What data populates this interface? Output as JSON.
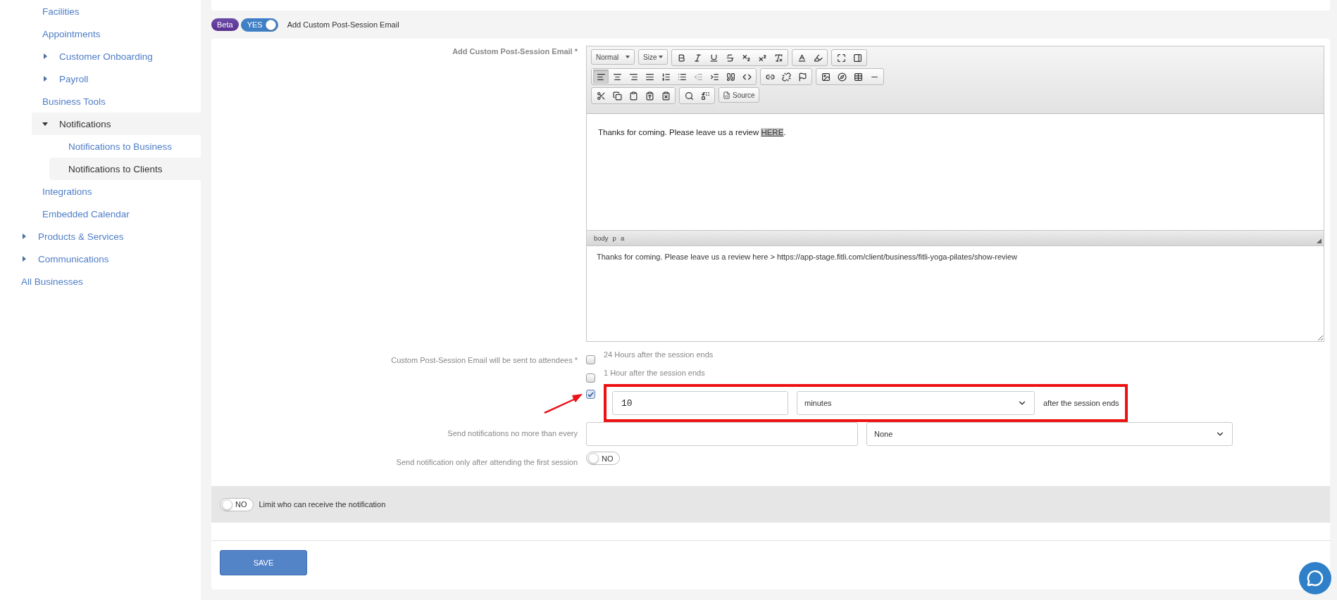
{
  "sidebar": {
    "nested_items": [
      {
        "label": "Facilities",
        "selected": false
      },
      {
        "label": "Appointments",
        "selected": false
      },
      {
        "label": "Customer Onboarding",
        "expanded": false,
        "selected": false
      },
      {
        "label": "Payroll",
        "expanded": false,
        "selected": false
      },
      {
        "label": "Business Tools",
        "selected": false
      },
      {
        "label": "Notifications",
        "expanded": true,
        "selected": true,
        "children": [
          {
            "label": "Notifications to Business",
            "selected": false
          },
          {
            "label": "Notifications to Clients",
            "selected": true
          }
        ]
      },
      {
        "label": "Integrations",
        "selected": false
      },
      {
        "label": "Embedded Calendar",
        "selected": false
      }
    ],
    "items": [
      {
        "label": "Products & Services",
        "expanded": false,
        "selected": false
      },
      {
        "label": "Communications",
        "expanded": false,
        "selected": false
      },
      {
        "label": "All Businesses",
        "selected": false
      }
    ]
  },
  "header": {
    "badge": "Beta",
    "toggle": {
      "on": true,
      "label": "YES"
    },
    "title": "Add Custom Post-Session Email"
  },
  "editor": {
    "label": "Add Custom Post-Session Email *",
    "format_dropdown": "Normal",
    "size_dropdown": "Size",
    "source_button": "Source",
    "alignment": [
      {
        "selected": true
      },
      {
        "selected": false
      },
      {
        "selected": false
      },
      {
        "selected": false
      }
    ],
    "content": {
      "text_before": "Thanks for coming. Please leave us a review ",
      "link": "HERE",
      "text_after": "."
    },
    "path": [
      "body",
      "p",
      "a"
    ],
    "plain_text": "Thanks for coming. Please leave us a review here > https://app-stage.fitli.com/client/business/fitli-yoga-pilates/show-review"
  },
  "schedule": {
    "label": "Custom Post-Session Email will be sent to attendees *",
    "options": [
      {
        "kind": "preset",
        "label": "24 Hours after the session ends",
        "checked": false
      },
      {
        "kind": "preset",
        "label": "1 Hour after the session ends",
        "checked": false
      },
      {
        "kind": "custom",
        "checked": true,
        "value": "10",
        "unit": "minutes",
        "suffix": "after the session ends",
        "highlighted": true
      }
    ]
  },
  "frequency": {
    "label": "Send notifications no more than every",
    "unit": "None"
  },
  "first_session": {
    "label": "Send notification only after attending the first session",
    "toggle": {
      "on": false,
      "label": "NO"
    }
  },
  "limit": {
    "toggle": {
      "on": false,
      "label": "NO"
    },
    "label": "Limit who can receive the notification"
  },
  "save_button": "SAVE"
}
